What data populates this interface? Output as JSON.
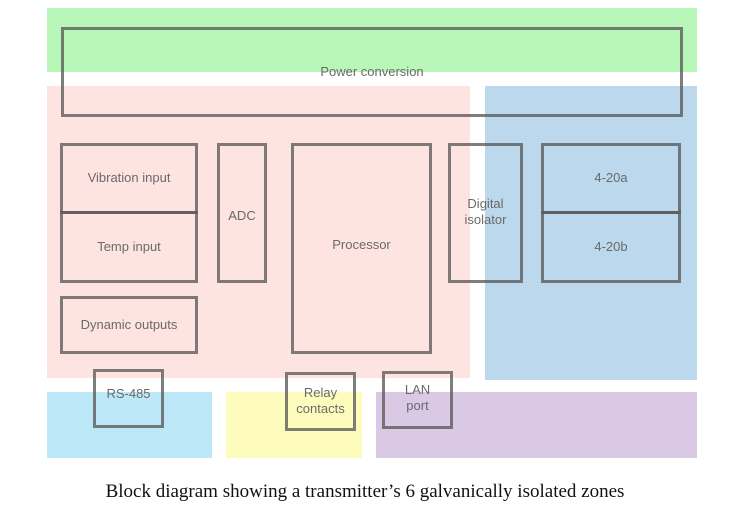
{
  "zones": {
    "power": {
      "color": "#b9f7b9"
    },
    "main": {
      "color": "#fde4e1"
    },
    "analog_out": {
      "color": "#bcd8ec"
    },
    "rs485": {
      "color": "#bde8f7"
    },
    "relay": {
      "color": "#fdfcbd"
    },
    "lan": {
      "color": "#dac9e4"
    }
  },
  "blocks": {
    "power_conversion": "Power conversion",
    "vibration_input": "Vibration input",
    "temp_input": "Temp  input",
    "adc": "ADC",
    "processor": "Processor",
    "digital_isolator": "Digital\nisolator",
    "out_a": "4-20a",
    "out_b": "4-20b",
    "dynamic_outputs": "Dynamic outputs",
    "rs485": "RS-485",
    "relay_contacts": "Relay\ncontacts",
    "lan_port": "LAN\nport"
  },
  "caption": "Block diagram showing a transmitter’s 6 galvanically isolated zones"
}
